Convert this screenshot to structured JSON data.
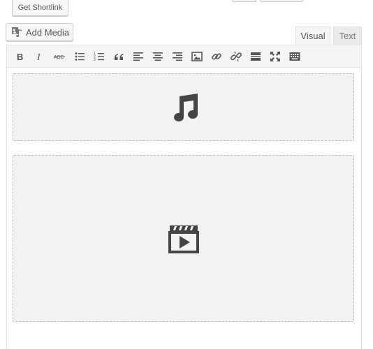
{
  "top": {
    "shortlink_label": "Get Shortlink"
  },
  "media": {
    "add_media_label": "Add Media"
  },
  "tabs": [
    {
      "label": "Visual",
      "active": true
    },
    {
      "label": "Text",
      "active": false
    }
  ],
  "toolbar": {
    "icons": [
      "bold-icon",
      "italic-icon",
      "strikethrough-icon",
      "bullet-list-icon",
      "numbered-list-icon",
      "blockquote-icon",
      "align-left-icon",
      "align-center-icon",
      "align-right-icon",
      "image-icon",
      "link-icon",
      "unlink-icon",
      "read-more-icon",
      "fullscreen-icon",
      "toolbar-toggle-icon"
    ]
  },
  "placeholders": [
    {
      "kind": "audio",
      "icon": "music-note-icon"
    },
    {
      "kind": "video",
      "icon": "video-icon"
    }
  ],
  "colors": {
    "icon": "#555555",
    "placeholder_bg": "#f2f2f2",
    "border": "#bbbbbb"
  }
}
